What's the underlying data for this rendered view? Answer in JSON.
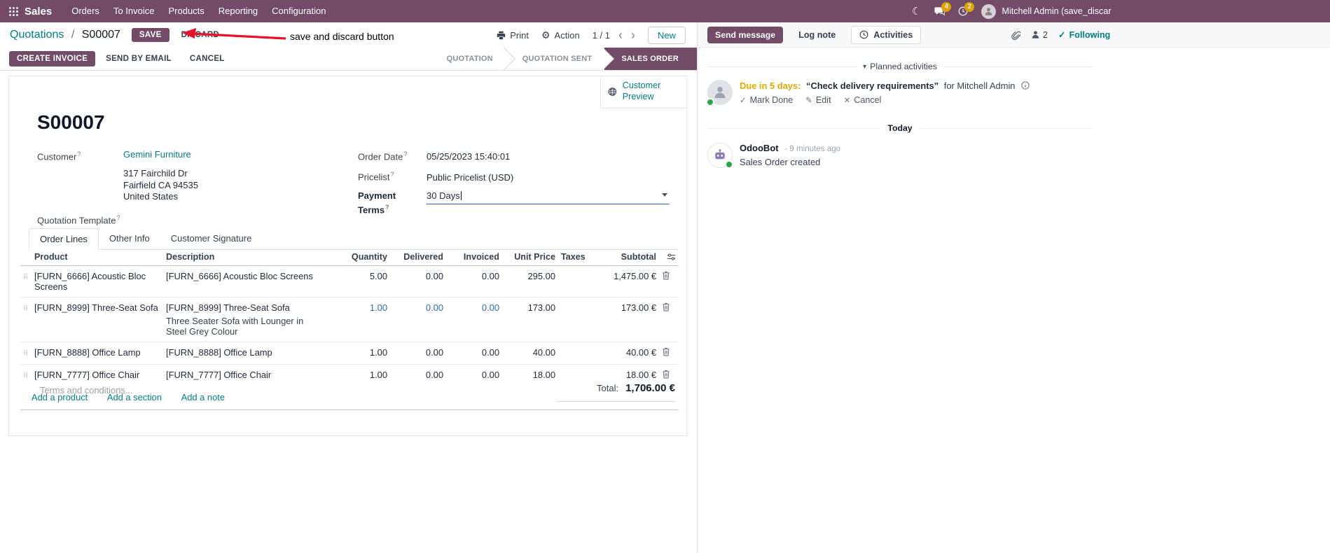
{
  "colors": {
    "primary": "#714B67",
    "link": "#017e84",
    "edited": "#2b6cb0",
    "warning": "#e4a900",
    "presence": "#28a745",
    "arrow": "#e8112d"
  },
  "icons": {
    "moon": "☾",
    "gear": "⚙",
    "chevron_left": "‹",
    "chevron_right": "›",
    "check": "✓",
    "pencil": "✎",
    "cross": "✕",
    "collapse": "▾",
    "question": "?",
    "drag": "⠿"
  },
  "nav": {
    "brand": "Sales",
    "items": [
      "Orders",
      "To Invoice",
      "Products",
      "Reporting",
      "Configuration"
    ],
    "systray": {
      "messages_badge": "4",
      "activities_badge": "2",
      "user_name": "Mitchell Admin (save_discar"
    }
  },
  "control": {
    "breadcrumb_app": "Quotations",
    "breadcrumb_sep": "/",
    "breadcrumb_doc": "S00007",
    "save": "SAVE",
    "discard": "DISCARD",
    "print": "Print",
    "action": "Action",
    "pager": "1 / 1",
    "new": "New"
  },
  "annotation": {
    "label": "save and discard button"
  },
  "header_buttons": {
    "create_invoice": "CREATE INVOICE",
    "send_by_email": "SEND BY EMAIL",
    "cancel": "CANCEL"
  },
  "statusbar": {
    "steps": [
      {
        "label": "QUOTATION"
      },
      {
        "label": "QUOTATION SENT"
      },
      {
        "label": "SALES ORDER"
      }
    ]
  },
  "sheet": {
    "customer_preview": "Customer Preview",
    "title": "S00007",
    "help_marker": "?",
    "fields": {
      "customer_label": "Customer",
      "customer_name": "Gemini Furniture",
      "address_line1": "317 Fairchild Dr",
      "address_line2": "Fairfield CA 94535",
      "address_line3": "United States",
      "quotation_template_label": "Quotation Template",
      "order_date_label": "Order Date",
      "order_date_value": "05/25/2023 15:40:01",
      "pricelist_label": "Pricelist",
      "pricelist_value": "Public Pricelist (USD)",
      "payment_terms_label": "Payment Terms",
      "payment_terms_value": "30 Days"
    },
    "tabs": [
      {
        "label": "Order Lines"
      },
      {
        "label": "Other Info"
      },
      {
        "label": "Customer Signature"
      }
    ],
    "table": {
      "headers": [
        "Product",
        "Description",
        "Quantity",
        "Delivered",
        "Invoiced",
        "Unit Price",
        "Taxes",
        "Subtotal"
      ],
      "rows": [
        {
          "product": "[FURN_6666] Acoustic Bloc Screens",
          "description": "[FURN_6666] Acoustic Bloc Screens",
          "quantity": "5.00",
          "delivered": "0.00",
          "invoiced": "0.00",
          "unit_price": "295.00",
          "subtotal": "1,475.00 €"
        },
        {
          "product": "[FURN_8999] Three-Seat Sofa",
          "description": "[FURN_8999] Three-Seat Sofa",
          "description2": "Three Seater Sofa with Lounger in Steel Grey Colour",
          "quantity": "1.00",
          "delivered": "0.00",
          "invoiced": "0.00",
          "unit_price": "173.00",
          "subtotal": "173.00 €"
        },
        {
          "product": "[FURN_8888] Office Lamp",
          "description": "[FURN_8888] Office Lamp",
          "quantity": "1.00",
          "delivered": "0.00",
          "invoiced": "0.00",
          "unit_price": "40.00",
          "subtotal": "40.00 €"
        },
        {
          "product": "[FURN_7777] Office Chair",
          "description": "[FURN_7777] Office Chair",
          "quantity": "1.00",
          "delivered": "0.00",
          "invoiced": "0.00",
          "unit_price": "18.00",
          "subtotal": "18.00 €"
        }
      ],
      "add_product": "Add a product",
      "add_section": "Add a section",
      "add_note": "Add a note"
    },
    "terms_placeholder": "Terms and conditions...",
    "total_label": "Total:",
    "total_value": "1,706.00 €"
  },
  "chatter": {
    "send_message": "Send message",
    "log_note": "Log note",
    "activities": "Activities",
    "followers_count": "2",
    "following": "Following",
    "planned_header": "Planned activities",
    "activity": {
      "due": "Due in 5 days:",
      "summary": "“Check delivery requirements”",
      "for_user": "for Mitchell Admin",
      "mark_done": "Mark Done",
      "edit": "Edit",
      "cancel": "Cancel"
    },
    "date_divider": "Today",
    "message": {
      "author": "OdooBot",
      "meta": "- 9 minutes ago",
      "body": "Sales Order created"
    }
  }
}
